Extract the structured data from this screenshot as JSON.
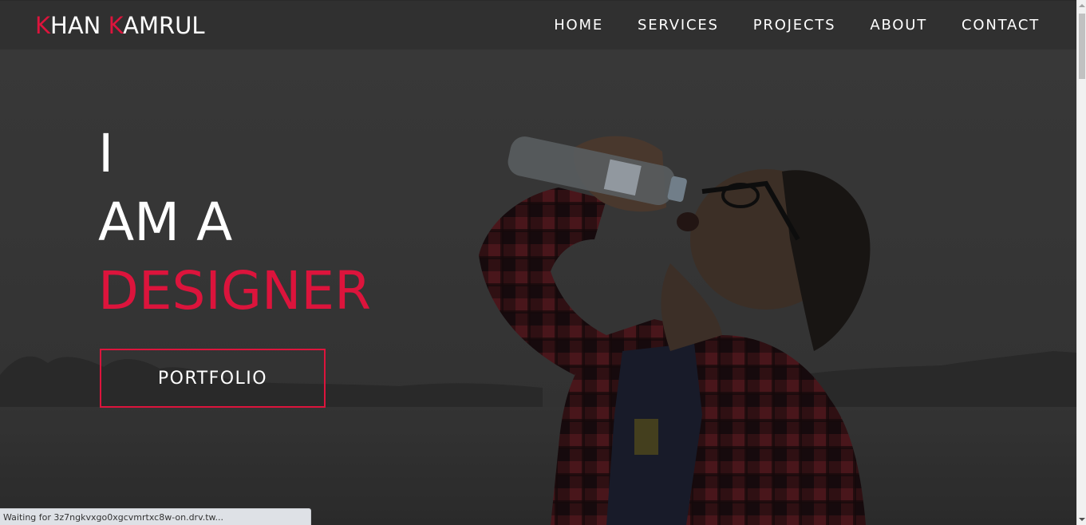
{
  "brand": {
    "first_initial": "K",
    "first_rest": "HAN ",
    "last_initial": "K",
    "last_rest": "AMRUL",
    "accent_color": "#dc143c"
  },
  "nav": {
    "items": [
      {
        "label": "HOME"
      },
      {
        "label": "SERVICES"
      },
      {
        "label": "PROJECTS"
      },
      {
        "label": "ABOUT"
      },
      {
        "label": "CONTACT"
      }
    ]
  },
  "hero": {
    "line1": "I",
    "line2": "AM A",
    "line3": "DESIGNER",
    "button_label": "PORTFOLIO",
    "image_icon": "person-drinking-water-photo"
  },
  "status_bar": {
    "text": "Waiting for 3z7ngkvxgo0xgcvmrtxc8w-on.drv.tw..."
  },
  "colors": {
    "accent": "#dc143c",
    "navbar": "#303030",
    "text": "#ffffff"
  }
}
